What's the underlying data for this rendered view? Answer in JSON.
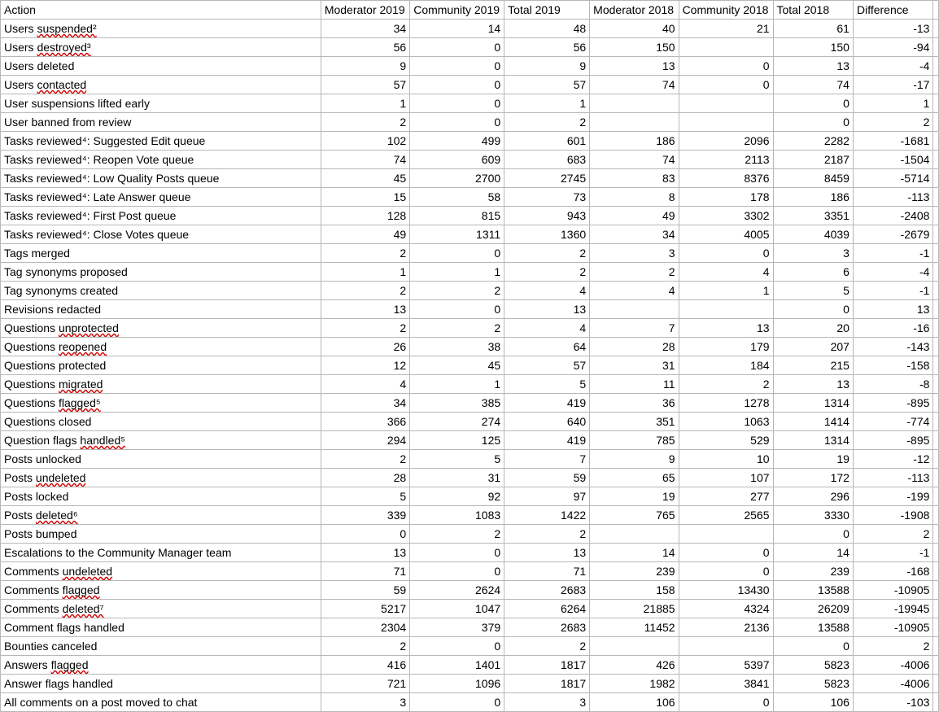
{
  "headers": [
    "Action",
    "Moderator 2019",
    "Community 2019",
    "Total 2019",
    "Moderator 2018",
    "Community 2018",
    "Total 2018",
    "Difference"
  ],
  "rows": [
    {
      "action": "Users suspended²",
      "cells": [
        "34",
        "14",
        "48",
        "40",
        "21",
        "61",
        "-13"
      ],
      "sp": [
        "suspended²"
      ]
    },
    {
      "action": "Users destroyed³",
      "cells": [
        "56",
        "0",
        "56",
        "150",
        "",
        "150",
        "-94"
      ],
      "sp": [
        "destroyed³"
      ]
    },
    {
      "action": "Users deleted",
      "cells": [
        "9",
        "0",
        "9",
        "13",
        "0",
        "13",
        "-4"
      ],
      "sp": []
    },
    {
      "action": "Users contacted",
      "cells": [
        "57",
        "0",
        "57",
        "74",
        "0",
        "74",
        "-17"
      ],
      "sp": [
        "contacted"
      ]
    },
    {
      "action": "User suspensions lifted early",
      "cells": [
        "1",
        "0",
        "1",
        "",
        "",
        "0",
        "1"
      ],
      "sp": []
    },
    {
      "action": "User banned from review",
      "cells": [
        "2",
        "0",
        "2",
        "",
        "",
        "0",
        "2"
      ],
      "sp": []
    },
    {
      "action": "Tasks reviewed⁴: Suggested Edit queue",
      "cells": [
        "102",
        "499",
        "601",
        "186",
        "2096",
        "2282",
        "-1681"
      ],
      "sp": [
        "reviewed⁴"
      ]
    },
    {
      "action": "Tasks reviewed⁴: Reopen Vote queue",
      "cells": [
        "74",
        "609",
        "683",
        "74",
        "2113",
        "2187",
        "-1504"
      ],
      "sp": [
        "reviewed⁴"
      ]
    },
    {
      "action": "Tasks reviewed⁴: Low Quality Posts queue",
      "cells": [
        "45",
        "2700",
        "2745",
        "83",
        "8376",
        "8459",
        "-5714"
      ],
      "sp": [
        "reviewed⁴"
      ]
    },
    {
      "action": "Tasks reviewed⁴: Late Answer queue",
      "cells": [
        "15",
        "58",
        "73",
        "8",
        "178",
        "186",
        "-113"
      ],
      "sp": [
        "reviewed⁴"
      ]
    },
    {
      "action": "Tasks reviewed⁴: First Post queue",
      "cells": [
        "128",
        "815",
        "943",
        "49",
        "3302",
        "3351",
        "-2408"
      ],
      "sp": [
        "reviewed⁴"
      ]
    },
    {
      "action": "Tasks reviewed⁴: Close Votes queue",
      "cells": [
        "49",
        "1311",
        "1360",
        "34",
        "4005",
        "4039",
        "-2679"
      ],
      "sp": [
        "reviewed⁴"
      ]
    },
    {
      "action": "Tags merged",
      "cells": [
        "2",
        "0",
        "2",
        "3",
        "0",
        "3",
        "-1"
      ],
      "sp": []
    },
    {
      "action": "Tag synonyms proposed",
      "cells": [
        "1",
        "1",
        "2",
        "2",
        "4",
        "6",
        "-4"
      ],
      "sp": []
    },
    {
      "action": "Tag synonyms created",
      "cells": [
        "2",
        "2",
        "4",
        "4",
        "1",
        "5",
        "-1"
      ],
      "sp": []
    },
    {
      "action": "Revisions redacted",
      "cells": [
        "13",
        "0",
        "13",
        "",
        "",
        "0",
        "13"
      ],
      "sp": []
    },
    {
      "action": "Questions unprotected",
      "cells": [
        "2",
        "2",
        "4",
        "7",
        "13",
        "20",
        "-16"
      ],
      "sp": [
        "unprotected"
      ]
    },
    {
      "action": "Questions reopened",
      "cells": [
        "26",
        "38",
        "64",
        "28",
        "179",
        "207",
        "-143"
      ],
      "sp": [
        "reopened"
      ]
    },
    {
      "action": "Questions protected",
      "cells": [
        "12",
        "45",
        "57",
        "31",
        "184",
        "215",
        "-158"
      ],
      "sp": []
    },
    {
      "action": "Questions migrated",
      "cells": [
        "4",
        "1",
        "5",
        "11",
        "2",
        "13",
        "-8"
      ],
      "sp": [
        "migrated"
      ]
    },
    {
      "action": "Questions flagged⁵",
      "cells": [
        "34",
        "385",
        "419",
        "36",
        "1278",
        "1314",
        "-895"
      ],
      "sp": [
        "flagged⁵"
      ]
    },
    {
      "action": "Questions closed",
      "cells": [
        "366",
        "274",
        "640",
        "351",
        "1063",
        "1414",
        "-774"
      ],
      "sp": []
    },
    {
      "action": "Question flags handled⁵",
      "cells": [
        "294",
        "125",
        "419",
        "785",
        "529",
        "1314",
        "-895"
      ],
      "sp": [
        "handled⁵"
      ]
    },
    {
      "action": "Posts unlocked",
      "cells": [
        "2",
        "5",
        "7",
        "9",
        "10",
        "19",
        "-12"
      ],
      "sp": []
    },
    {
      "action": "Posts undeleted",
      "cells": [
        "28",
        "31",
        "59",
        "65",
        "107",
        "172",
        "-113"
      ],
      "sp": [
        "undeleted"
      ]
    },
    {
      "action": "Posts locked",
      "cells": [
        "5",
        "92",
        "97",
        "19",
        "277",
        "296",
        "-199"
      ],
      "sp": []
    },
    {
      "action": "Posts deleted⁶",
      "cells": [
        "339",
        "1083",
        "1422",
        "765",
        "2565",
        "3330",
        "-1908"
      ],
      "sp": [
        "deleted⁶"
      ]
    },
    {
      "action": "Posts bumped",
      "cells": [
        "0",
        "2",
        "2",
        "",
        "",
        "0",
        "2"
      ],
      "sp": []
    },
    {
      "action": "Escalations to the Community Manager team",
      "cells": [
        "13",
        "0",
        "13",
        "14",
        "0",
        "14",
        "-1"
      ],
      "sp": []
    },
    {
      "action": "Comments undeleted",
      "cells": [
        "71",
        "0",
        "71",
        "239",
        "0",
        "239",
        "-168"
      ],
      "sp": [
        "undeleted"
      ]
    },
    {
      "action": "Comments flagged",
      "cells": [
        "59",
        "2624",
        "2683",
        "158",
        "13430",
        "13588",
        "-10905"
      ],
      "sp": [
        "flagged"
      ]
    },
    {
      "action": "Comments deleted⁷",
      "cells": [
        "5217",
        "1047",
        "6264",
        "21885",
        "4324",
        "26209",
        "-19945"
      ],
      "sp": [
        "deleted⁷"
      ]
    },
    {
      "action": "Comment flags handled",
      "cells": [
        "2304",
        "379",
        "2683",
        "11452",
        "2136",
        "13588",
        "-10905"
      ],
      "sp": []
    },
    {
      "action": "Bounties canceled",
      "cells": [
        "2",
        "0",
        "2",
        "",
        "",
        "0",
        "2"
      ],
      "sp": []
    },
    {
      "action": "Answers flagged",
      "cells": [
        "416",
        "1401",
        "1817",
        "426",
        "5397",
        "5823",
        "-4006"
      ],
      "sp": [
        "flagged"
      ]
    },
    {
      "action": "Answer flags handled",
      "cells": [
        "721",
        "1096",
        "1817",
        "1982",
        "3841",
        "5823",
        "-4006"
      ],
      "sp": []
    },
    {
      "action": "All comments on a post moved to chat",
      "cells": [
        "3",
        "0",
        "3",
        "106",
        "0",
        "106",
        "-103"
      ],
      "sp": []
    }
  ]
}
